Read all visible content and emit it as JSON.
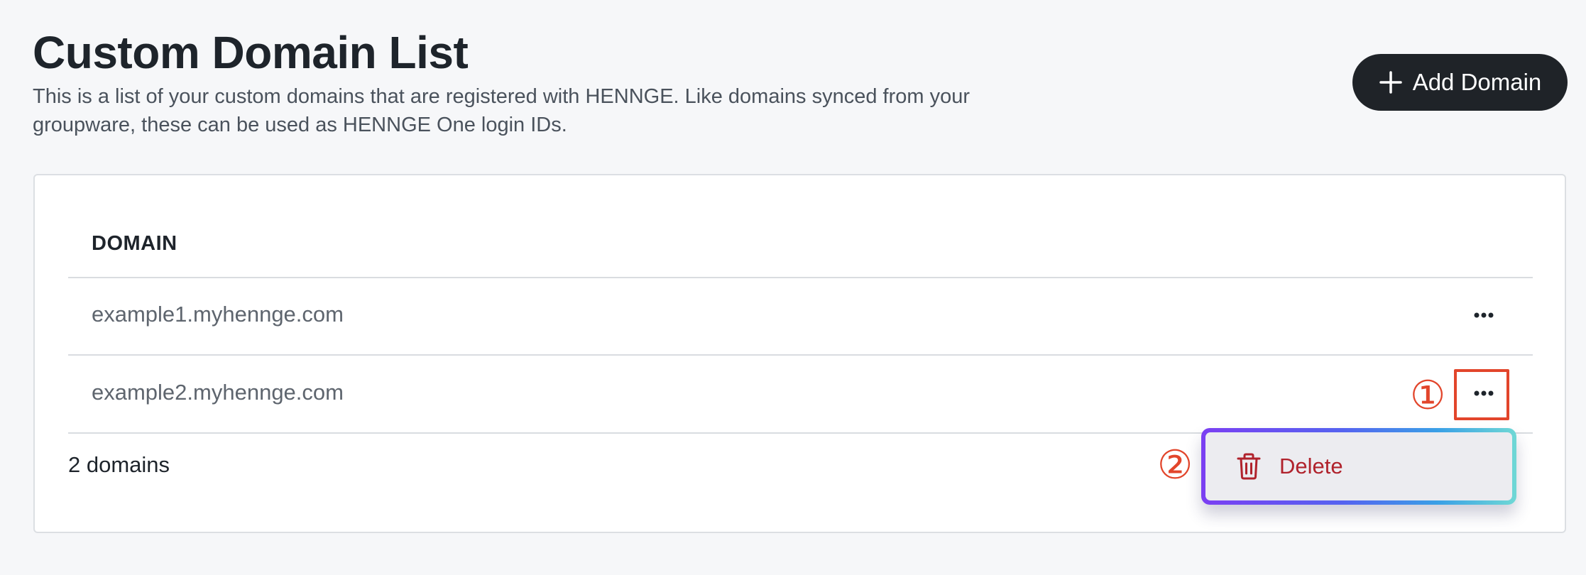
{
  "header": {
    "title": "Custom Domain List",
    "description": "This is a list of your custom domains that are registered with HENNGE. Like domains synced from your groupware, these can be used as HENNGE One login IDs.",
    "add_button_label": "Add Domain"
  },
  "table": {
    "column_header": "DOMAIN",
    "rows": [
      {
        "domain": "example1.myhennge.com"
      },
      {
        "domain": "example2.myhennge.com"
      }
    ],
    "footer_count": "2 domains"
  },
  "context_menu": {
    "items": [
      {
        "label": "Delete",
        "icon": "trash-icon"
      }
    ]
  },
  "annotations": {
    "step1": "①",
    "step2": "②"
  },
  "colors": {
    "primary_button": "#1f2328",
    "danger": "#b0222c",
    "annotation": "#e2452b",
    "menu_gradient_start": "#7b3ff2",
    "menu_gradient_end": "#6fd8d5"
  }
}
